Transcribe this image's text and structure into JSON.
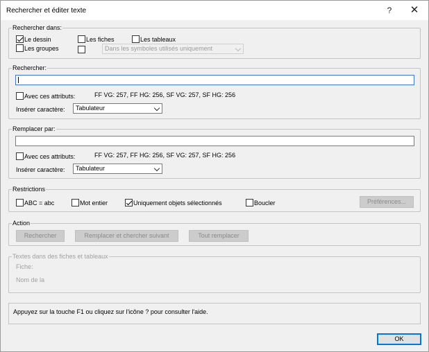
{
  "window": {
    "title": "Rechercher et éditer texte",
    "help_glyph": "?",
    "close_glyph": "✕"
  },
  "search_in": {
    "legend": "Rechercher dans:",
    "drawing": {
      "label": "Le dessin",
      "checked": true
    },
    "sheets": {
      "label": "Les fiches",
      "checked": false
    },
    "tables": {
      "label": "Les tableaux",
      "checked": false
    },
    "groups": {
      "label": "Les groupes",
      "checked": false
    },
    "symbols_checked": false,
    "symbols_select": "Dans les symboles utilisés uniquement"
  },
  "find": {
    "legend": "Rechercher:",
    "value": "",
    "attributes_label": "Avec ces attributs:",
    "attributes_checked": false,
    "attributes_value": "FF VG: 257, FF HG: 256, SF VG: 257, SF HG: 256",
    "insert_label": "Insérer caractère:",
    "insert_value": "Tabulateur"
  },
  "replace": {
    "legend": "Remplacer par:",
    "value": "",
    "attributes_label": "Avec ces attributs:",
    "attributes_checked": false,
    "attributes_value": "FF VG: 257, FF HG: 256, SF VG: 257, SF HG: 256",
    "insert_label": "Insérer caractère:",
    "insert_value": "Tabulateur"
  },
  "restrictions": {
    "legend": "Restrictions",
    "case": {
      "label": "ABC = abc",
      "checked": false
    },
    "whole_word": {
      "label": "Mot entier",
      "checked": false
    },
    "selected_only": {
      "label": "Uniquement objets sélectionnés",
      "checked": true
    },
    "loop": {
      "label": "Boucler",
      "checked": false
    },
    "preferences_button": "Préférences..."
  },
  "action": {
    "legend": "Action",
    "search_button": "Rechercher",
    "replace_next_button": "Remplacer et chercher suivant",
    "replace_all_button": "Tout remplacer"
  },
  "texts": {
    "legend": "Textes dans des fiches et tableaux",
    "sheet_label": "Fiche:",
    "name_label": "Nom de la"
  },
  "help_text": "Appuyez sur la touche F1 ou cliquez sur l'icône ? pour consulter l'aide.",
  "ok_button": "OK"
}
